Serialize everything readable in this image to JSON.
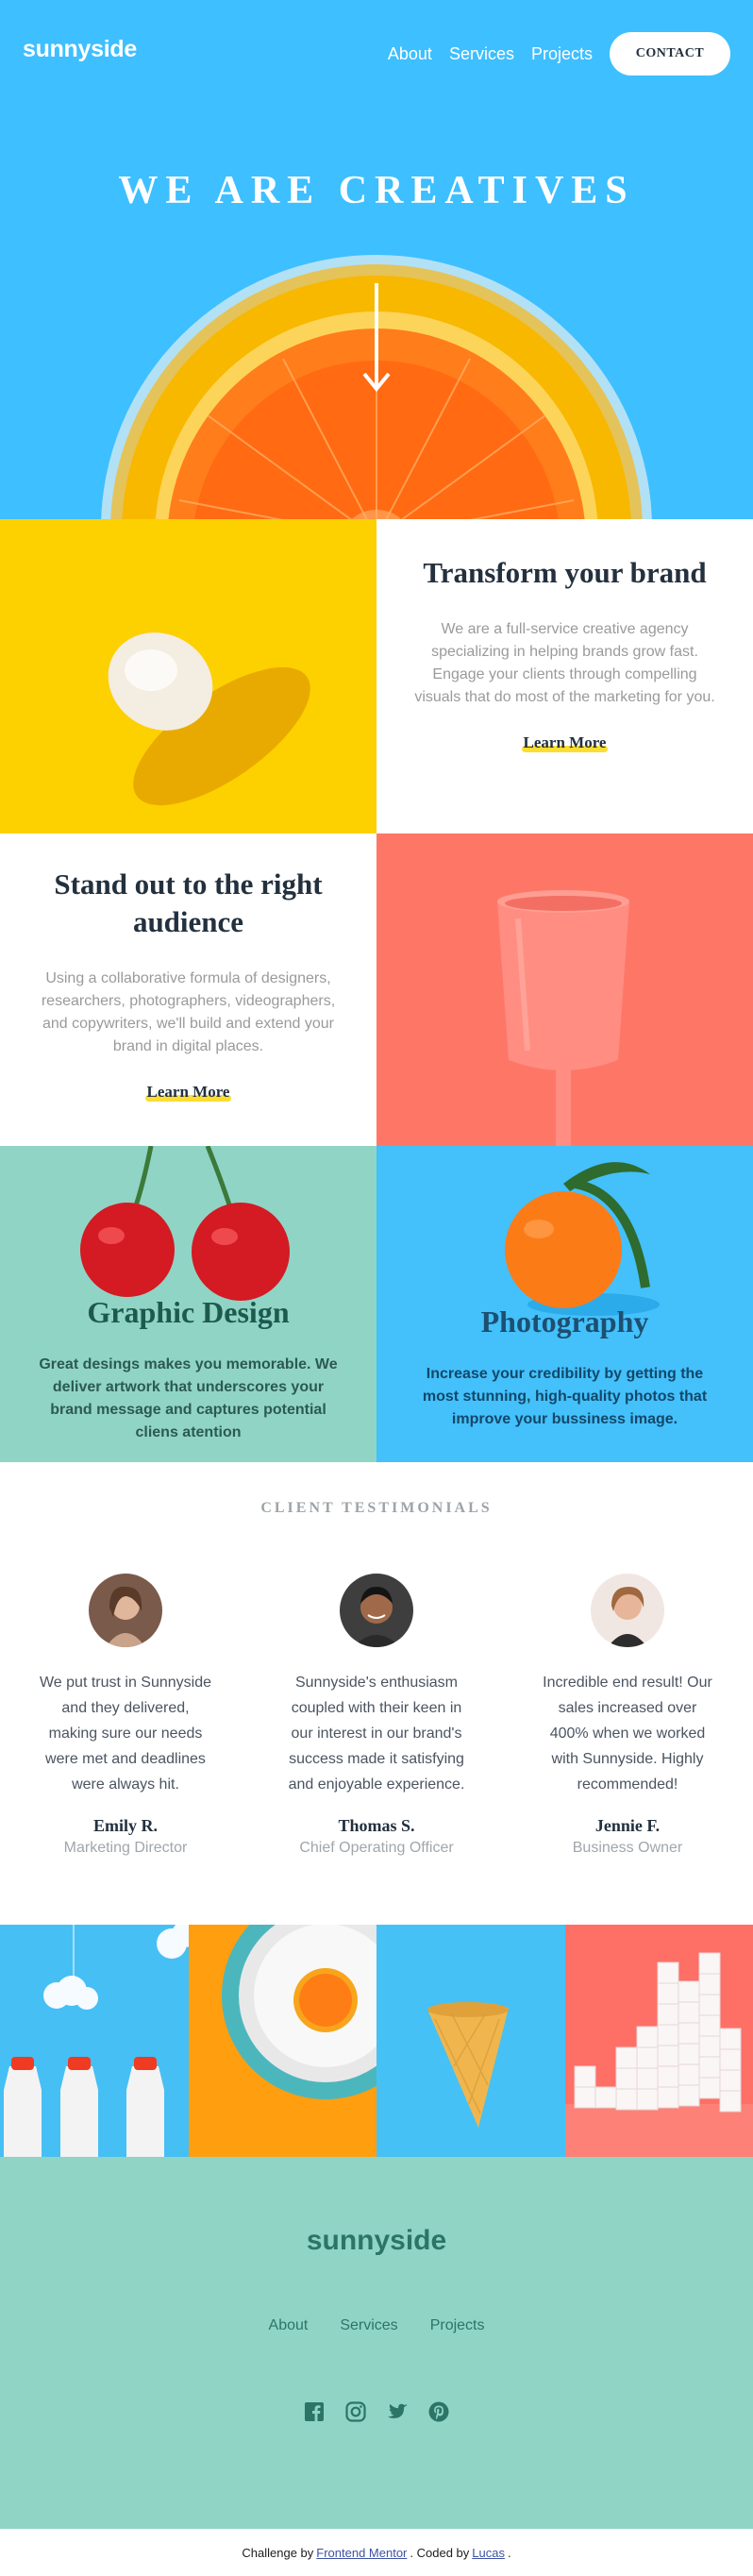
{
  "brand": {
    "logo": "sunnyside"
  },
  "nav": {
    "links": [
      "About",
      "Services",
      "Projects"
    ],
    "contact": "CONTACT"
  },
  "hero": {
    "title": "WE ARE CREATIVES"
  },
  "features": [
    {
      "title": "Transform your brand",
      "body": "We are a full-service creative agency specializing in helping brands grow fast. Engage your clients through compelling visuals that do most of the marketing for you.",
      "link": "Learn More"
    },
    {
      "title": "Stand out to the right audience",
      "body": "Using a collaborative formula of designers, researchers, photographers, videographers, and copywriters, we'll build and extend your brand in digital places.",
      "link": "Learn More"
    }
  ],
  "services": [
    {
      "title": "Graphic Design",
      "body": "Great desings makes you memorable. We deliver artwork that underscores your brand message and captures potential cliens atention"
    },
    {
      "title": "Photography",
      "body": "Increase your credibility by getting the most stunning, high-quality photos that improve your bussiness image."
    }
  ],
  "testimonials": {
    "heading": "CLIENT TESTIMONIALS",
    "items": [
      {
        "quote": "We put trust in Sunnyside and they delivered, making sure our needs were met and deadlines were always hit.",
        "name": "Emily R.",
        "role": "Marketing Director"
      },
      {
        "quote": "Sunnyside's enthusiasm coupled with their keen in our interest in our brand's success made it satisfying and enjoyable experience.",
        "name": "Thomas S.",
        "role": "Chief Operating Officer"
      },
      {
        "quote": "Incredible end result! Our sales increased over 400% when we worked with Sunnyside. Highly recommended!",
        "name": "Jennie F.",
        "role": "Business Owner"
      }
    ]
  },
  "footer": {
    "logo": "sunnyside",
    "links": [
      "About",
      "Services",
      "Projects"
    ],
    "socials": [
      "facebook-icon",
      "instagram-icon",
      "twitter-icon",
      "pinterest-icon"
    ]
  },
  "attribution": {
    "prefix": "Challenge by",
    "link1": "Frontend Mentor",
    "middle": ". Coded by",
    "link2": "Lucas",
    "suffix": "."
  },
  "colors": {
    "hero_blue": "#3ebfff",
    "yellow": "#fad400",
    "coral": "#fe7766",
    "mint": "#90d4c6",
    "dark": "#23303e"
  }
}
